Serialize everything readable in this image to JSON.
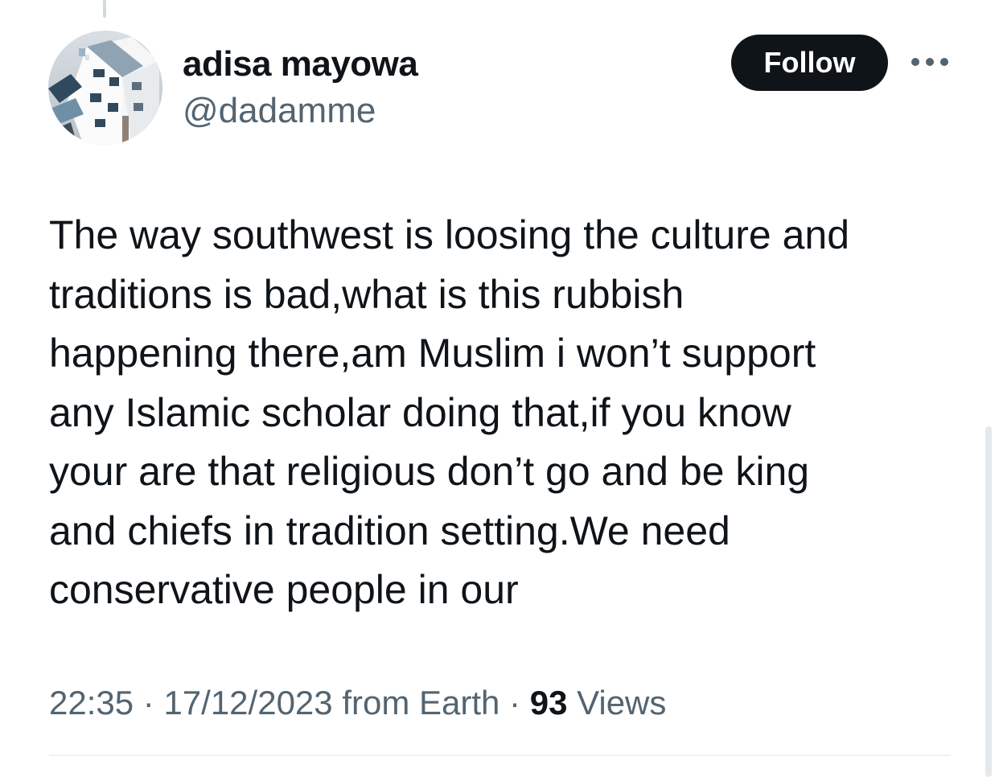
{
  "user": {
    "display_name": "adisa mayowa",
    "handle": "@dadamme"
  },
  "actions": {
    "follow_label": "Follow",
    "more_icon": "more-horizontal-icon"
  },
  "avatar": {
    "icon": "building-avatar-image"
  },
  "tweet": {
    "lines": [
      "The way southwest is loosing the culture and",
      "traditions is bad,what is this rubbish",
      "happening there,am Muslim i won’t support",
      "any Islamic scholar doing that,if you know",
      "your are that religious don’t go and be king",
      "and chiefs in tradition setting.We need",
      "conservative people in our"
    ]
  },
  "meta": {
    "time": "22:35",
    "separator": " · ",
    "date": "17/12/2023",
    "source": " from Earth",
    "views_count": "93",
    "views_label": " Views"
  },
  "colors": {
    "text": "#0f1419",
    "secondary_text": "#536471",
    "follow_background": "#0f1419",
    "divider": "#eff3f4"
  }
}
